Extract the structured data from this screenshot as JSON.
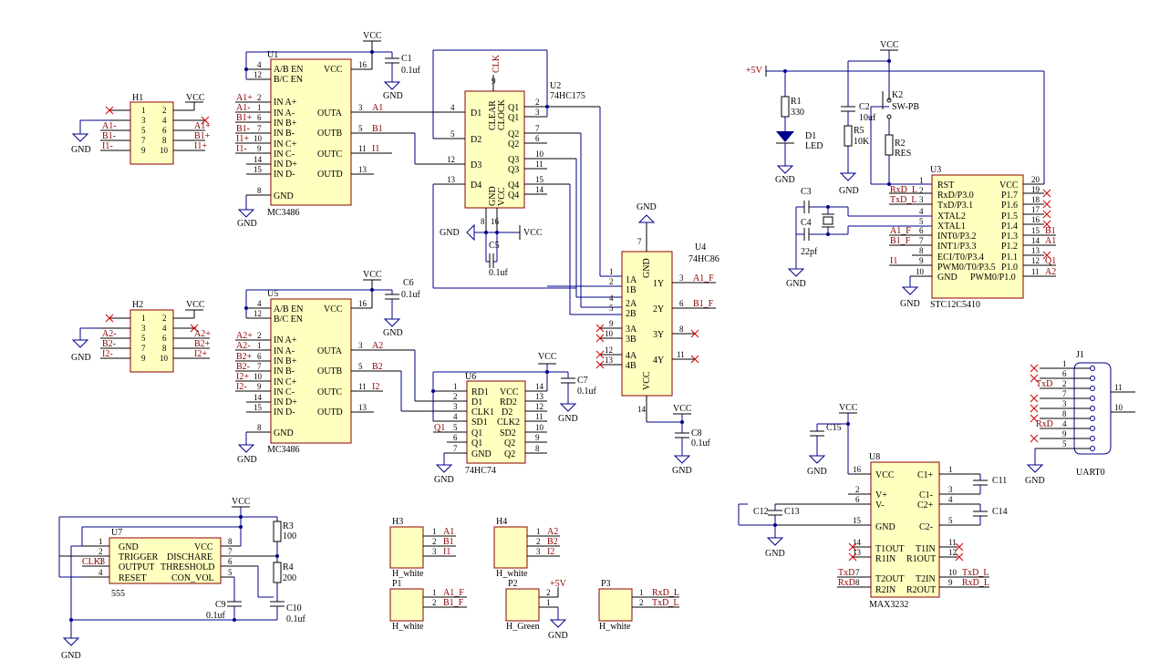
{
  "power": {
    "vcc": "VCC",
    "gnd": "GND",
    "p5": "+5V"
  },
  "u1": {
    "ref": "U1",
    "part": "MC3486",
    "in_pins": [
      "A/B EN",
      "B/C EN",
      "IN A+",
      "IN A-",
      "IN B+",
      "IN B-",
      "IN C+",
      "IN C-",
      "IN D+",
      "IN D-",
      "GND"
    ],
    "out_pins": [
      "VCC",
      "OUTA",
      "OUTB",
      "OUTC",
      "OUTD"
    ],
    "left_nets": [
      "A1+",
      "A1-",
      "B1+",
      "B1-",
      "I1+",
      "I1-"
    ],
    "out_nets": [
      "A1",
      "B1",
      "I1"
    ]
  },
  "u5": {
    "ref": "U5",
    "part": "MC3486",
    "left_nets": [
      "A2+",
      "A2-",
      "B2+",
      "B2-",
      "I2+",
      "I2-"
    ],
    "out_nets": [
      "A2",
      "B2",
      "I2"
    ]
  },
  "c1": {
    "ref": "C1",
    "val": "0.1uf"
  },
  "c6": {
    "ref": "C6",
    "val": "0.1uf"
  },
  "h1": {
    "ref": "H1",
    "left": [
      "A1-",
      "B1-",
      "I1-"
    ],
    "right": [
      "A1+",
      "B1+",
      "I1+"
    ]
  },
  "h2": {
    "ref": "H2",
    "left": [
      "A2-",
      "B2-",
      "I2-"
    ],
    "right": [
      "A2+",
      "B2+",
      "I2+"
    ]
  },
  "u2": {
    "ref": "U2",
    "part": "74HC175",
    "pins_l": [
      "D1",
      "D2",
      "D3",
      "D4"
    ],
    "pins_r": [
      "Q1",
      "Q1",
      "Q2",
      "Q2",
      "Q3",
      "Q3",
      "Q4",
      "Q4"
    ],
    "top": [
      "CLEAR",
      "CLOCK"
    ],
    "bot": [
      "GND",
      "VCC"
    ],
    "clk": "CLK"
  },
  "c5": {
    "ref": "C5",
    "val": "0.1uf"
  },
  "u4": {
    "ref": "U4",
    "part": "74HC86",
    "pins_l": [
      "1A",
      "1B",
      "2A",
      "2B",
      "3A",
      "3B",
      "4A",
      "4B"
    ],
    "pins_r": [
      "1Y",
      "2Y",
      "3Y",
      "4Y"
    ],
    "gnd": "GND",
    "vcc": "VCC",
    "outs": [
      "A1_F",
      "B1_F"
    ]
  },
  "c8": {
    "ref": "C8",
    "val": "0.1uf"
  },
  "u6": {
    "ref": "U6",
    "part": "74HC74",
    "pins_l": [
      "RD1",
      "D1",
      "CLK1",
      "SD1",
      "Q1",
      "Q1",
      "GND"
    ],
    "pins_r": [
      "VCC",
      "RD2",
      "D2",
      "CLK2",
      "SD2",
      "Q2",
      "Q2"
    ],
    "net_q1": "Q1"
  },
  "c7": {
    "ref": "C7",
    "val": "0.1uf"
  },
  "u7": {
    "ref": "U7",
    "part": "555",
    "pins_l": [
      "GND",
      "TRIGGER",
      "OUTPUT",
      "RESET"
    ],
    "pins_r": [
      "VCC",
      "DISCHARE",
      "THRESHOLD",
      "CON_VOL"
    ],
    "clk": "CLK3"
  },
  "r3": {
    "ref": "R3",
    "val": "100"
  },
  "r4": {
    "ref": "R4",
    "val": "200"
  },
  "c9": {
    "ref": "C9",
    "val": "0.1uf"
  },
  "c10": {
    "ref": "C10",
    "val": "0.1uf"
  },
  "r1": {
    "ref": "R1",
    "val": "330"
  },
  "d1": {
    "ref": "D1",
    "val": "LED"
  },
  "c2": {
    "ref": "C2",
    "val": "10uf"
  },
  "r5": {
    "ref": "R5",
    "val": "10K"
  },
  "k2": {
    "ref": "K2",
    "val": "SW-PB"
  },
  "r2": {
    "ref": "R2",
    "val": "RES"
  },
  "c3": {
    "ref": "C3"
  },
  "c4": {
    "ref": "C4",
    "val": "22pf"
  },
  "u3": {
    "ref": "U3",
    "part": "STC12C5410",
    "pins_l": [
      "RST",
      "RxD/P3.0",
      "TxD/P3.1",
      "XTAL2",
      "XTAL1",
      "INT0/P3.2",
      "INT1/P3.3",
      "ECI/T0/P3.4",
      "PWM0/T0/P3.5",
      "GND"
    ],
    "pins_r": [
      "VCC",
      "P1.7",
      "P1.6",
      "P1.5",
      "P1.4",
      "P1.3",
      "P1.2",
      "P1.1",
      "P1.0",
      "PWM0/P1.0"
    ],
    "nets_l": [
      "RxD_L",
      "TxD_L",
      "A1_F",
      "B1_F",
      "I1"
    ],
    "nets_r": [
      "B1",
      "A1",
      "Q1",
      "A2"
    ]
  },
  "j1": {
    "ref": "J1",
    "part": "UART0",
    "nets": [
      "TxD",
      "RxD"
    ]
  },
  "u8": {
    "ref": "U8",
    "part": "MAX3232",
    "pins_l": [
      "VCC",
      "V+",
      "V-",
      "GND",
      "T1OUT",
      "R1IN",
      "T2OUT",
      "R2IN"
    ],
    "pins_r": [
      "C1+",
      "C1-",
      "C2+",
      "C2-",
      "T1IN",
      "R1OUT",
      "T2IN",
      "R2OUT"
    ],
    "nets": [
      "TxD",
      "RxD",
      "TxD_L",
      "RxD_L"
    ]
  },
  "caps_u8": [
    "C11",
    "C12",
    "C13",
    "C14",
    "C15"
  ],
  "h3": {
    "ref": "H3",
    "nets": [
      "A1",
      "B1",
      "I1"
    ],
    "val": "H_white"
  },
  "h4": {
    "ref": "H4",
    "nets": [
      "A2",
      "B2",
      "I2"
    ],
    "val": "H_white"
  },
  "p1": {
    "ref": "P1",
    "nets": [
      "A1_F",
      "B1_F"
    ],
    "val": "H_white"
  },
  "p2": {
    "ref": "P2",
    "val": "H_Green"
  },
  "p3": {
    "ref": "P3",
    "nets": [
      "RxD_L",
      "TxD_L"
    ],
    "val": "H_white"
  }
}
